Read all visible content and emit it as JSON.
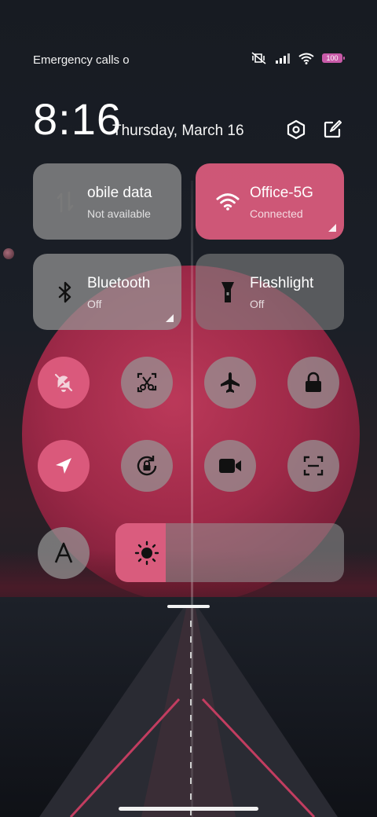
{
  "status_bar": {
    "carrier_text": "Emergency calls o",
    "battery": "100"
  },
  "header": {
    "time": "8:16",
    "date": "Thursday, March 16"
  },
  "tiles": {
    "mobile_data": {
      "title": "obile data",
      "subtitle": "Not available"
    },
    "wifi": {
      "title": "Office-5G",
      "subtitle": "Connected"
    },
    "bluetooth": {
      "title": "Bluetooth",
      "subtitle": "Off"
    },
    "flashlight": {
      "title": "Flashlight",
      "subtitle": "Off"
    }
  },
  "toggles": [
    {
      "name": "silent-mode",
      "icon": "bell-off-icon",
      "active": true
    },
    {
      "name": "screenshot",
      "icon": "scissors-icon",
      "active": false
    },
    {
      "name": "airplane-mode",
      "icon": "airplane-icon",
      "active": false
    },
    {
      "name": "lock-screen",
      "icon": "lock-icon",
      "active": false
    },
    {
      "name": "location",
      "icon": "location-arrow-icon",
      "active": true
    },
    {
      "name": "rotation-lock",
      "icon": "rotation-lock-icon",
      "active": false
    },
    {
      "name": "screen-recorder",
      "icon": "video-camera-icon",
      "active": false
    },
    {
      "name": "scanner",
      "icon": "scan-icon",
      "active": false
    },
    {
      "name": "font-size",
      "icon": "letter-a-icon",
      "active": false
    }
  ],
  "brightness": {
    "level": 0.22
  },
  "colors": {
    "accent": "#dd5c7e",
    "tile_inactive": "#969696",
    "battery": "#c85aa8"
  }
}
